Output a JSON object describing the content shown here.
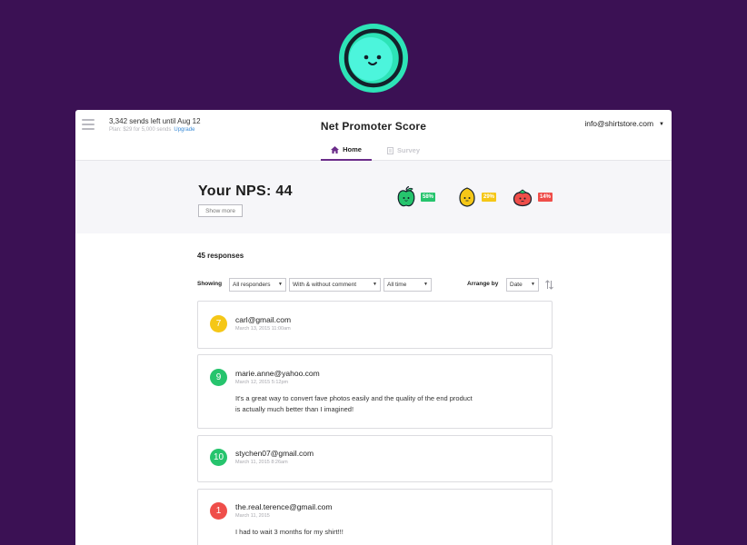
{
  "colors": {
    "background": "#3b1154",
    "accent": "#6b2d8a",
    "promoter": "#26c46d",
    "passive": "#f5c717",
    "detractor": "#ef4e4a",
    "link": "#3a8bd6"
  },
  "header": {
    "sends_left": "3,342 sends left until Aug 12",
    "plan": "Plan: $29 for 5,000 sends",
    "upgrade": "Upgrade",
    "title": "Net Promoter Score",
    "account": "info@shirtstore.com"
  },
  "tabs": [
    {
      "label": "Home",
      "icon": "home-icon",
      "active": true
    },
    {
      "label": "Survey",
      "icon": "document-icon",
      "active": false
    }
  ],
  "summary": {
    "nps_text": "Your NPS: 44",
    "show_more": "Show more",
    "stats": [
      {
        "icon": "apple-icon",
        "label": "58%",
        "color": "#26c46d"
      },
      {
        "icon": "lemon-icon",
        "label": "29%",
        "color": "#f5c717"
      },
      {
        "icon": "tomato-icon",
        "label": "14%",
        "color": "#ef4e4a"
      }
    ]
  },
  "responses": {
    "count_text": "45 responses",
    "showing_label": "Showing",
    "filter_responders": "All responders",
    "filter_comment": "With & without comment",
    "filter_time": "All time",
    "arrange_label": "Arrange by",
    "arrange_value": "Date",
    "items": [
      {
        "score": "7",
        "color": "#f5c717",
        "email": "carl@gmail.com",
        "date": "March 13, 2015   11:00am",
        "comment_lines": []
      },
      {
        "score": "9",
        "color": "#26c46d",
        "email": "marie.anne@yahoo.com",
        "date": "March 12, 2015   5:12pm",
        "comment_lines": [
          "It's a great way to convert fave photos easily and the quality of the end product",
          "is actually much better than I imagined!"
        ]
      },
      {
        "score": "10",
        "color": "#26c46d",
        "email": "stychen07@gmail.com",
        "date": "March 11, 2015   8:26am",
        "comment_lines": []
      },
      {
        "score": "1",
        "color": "#ef4e4a",
        "email": "the.real.terence@gmail.com",
        "date": "March 11, 2015",
        "comment_lines": [
          "I had to wait 3 months for my shirt!!!"
        ]
      }
    ]
  }
}
